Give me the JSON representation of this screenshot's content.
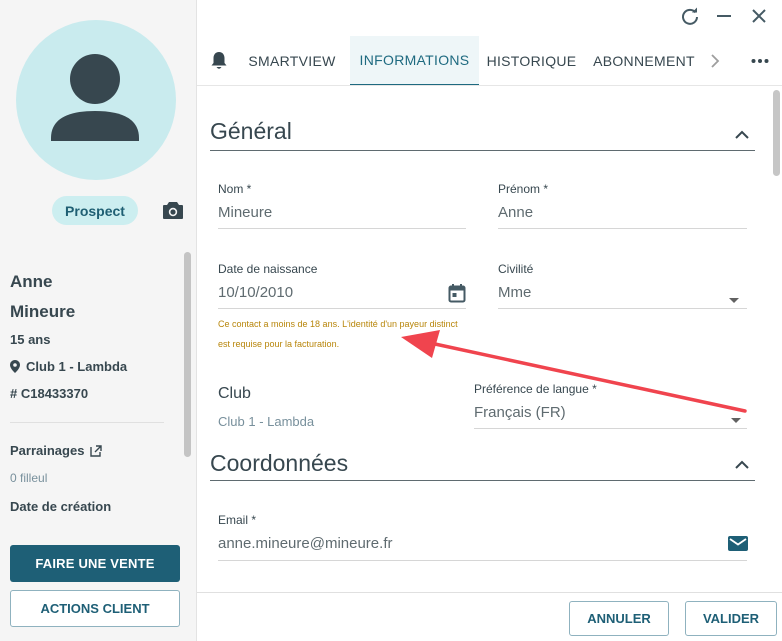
{
  "sidebar": {
    "status_label": "Prospect",
    "first_name": "Anne",
    "last_name": "Mineure",
    "age": "15 ans",
    "club": "Club 1 - Lambda",
    "client_id": "# C18433370",
    "referrals_label": "Parrainages",
    "referrals_value": "0 filleul",
    "creation_date_label": "Date de création",
    "sale_button": "FAIRE UNE VENTE",
    "actions_button": "ACTIONS CLIENT"
  },
  "tabs": [
    {
      "label": "SMARTVIEW"
    },
    {
      "label": "INFORMATIONS",
      "active": true
    },
    {
      "label": "HISTORIQUE"
    },
    {
      "label": "ABONNEMENT"
    }
  ],
  "icons": {
    "notifications": "bell-icon",
    "tabs_next": "chevron-right-icon",
    "more": "more-horizontal-icon",
    "refresh": "refresh-icon",
    "minimize": "minimize-icon",
    "close": "close-icon",
    "camera": "camera-icon",
    "location": "location-pin-icon",
    "external": "external-link-icon",
    "calendar": "calendar-icon",
    "email": "email-icon"
  },
  "sections": {
    "general": "Général",
    "contact": "Coordonnées"
  },
  "fields": {
    "last_name_label": "Nom *",
    "last_name_value": "Mineure",
    "first_name_label": "Prénom *",
    "first_name_value": "Anne",
    "birthdate_label": "Date de naissance",
    "birthdate_value": "10/10/2010",
    "civility_label": "Civilité",
    "civility_value": "Mme",
    "minor_warning": "Ce contact a moins de 18 ans. L'identité d'un payeur distinct est requise pour la facturation.",
    "club_label": "Club",
    "club_value": "Club 1 - Lambda",
    "language_label": "Préférence de langue *",
    "language_value": "Français (FR)",
    "email_label": "Email *",
    "email_value": "anne.mineure@mineure.fr"
  },
  "footer": {
    "cancel": "ANNULER",
    "validate": "VALIDER"
  },
  "colors": {
    "primary": "#1e5f76",
    "avatar_bg": "#c9ebee",
    "warning": "#b8860b",
    "annotation_arrow": "#f0444e"
  }
}
